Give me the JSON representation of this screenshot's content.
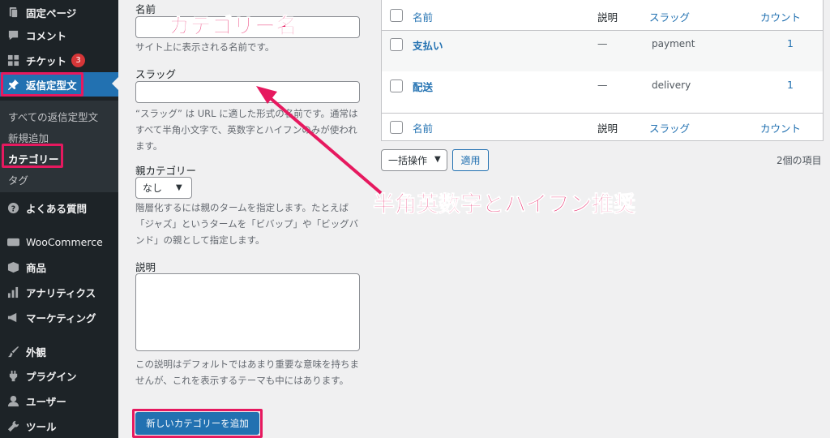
{
  "sidebar": {
    "items": [
      {
        "label": "固定ページ",
        "icon": "pages-icon"
      },
      {
        "label": "コメント",
        "icon": "comment-icon"
      },
      {
        "label": "チケット",
        "icon": "ticket-icon",
        "badge": "3"
      },
      {
        "label": "返信定型文",
        "icon": "pin-icon"
      },
      {
        "label": "よくある質問",
        "icon": "help-icon"
      },
      {
        "label": "WooCommerce",
        "icon": "woocommerce-icon"
      },
      {
        "label": "商品",
        "icon": "product-icon"
      },
      {
        "label": "アナリティクス",
        "icon": "analytics-icon"
      },
      {
        "label": "マーケティング",
        "icon": "megaphone-icon"
      },
      {
        "label": "外観",
        "icon": "brush-icon"
      },
      {
        "label": "プラグイン",
        "icon": "plugin-icon"
      },
      {
        "label": "ユーザー",
        "icon": "user-icon"
      },
      {
        "label": "ツール",
        "icon": "wrench-icon"
      }
    ],
    "submenu": [
      "すべての返信定型文",
      "新規追加",
      "カテゴリー",
      "タグ"
    ]
  },
  "form": {
    "name_label": "名前",
    "name_help": "サイト上に表示される名前です。",
    "slug_label": "スラッグ",
    "slug_help": "“スラッグ” は URL に適した形式の名前です。通常はすべて半角小文字で、英数字とハイフンのみが使われます。",
    "parent_label": "親カテゴリー",
    "parent_value": "なし",
    "parent_help": "階層化するには親のタームを指定します。たとえば「ジャズ」というタームを「ビバップ」や「ビッグバンド」の親として指定します。",
    "desc_label": "説明",
    "desc_help": "この説明はデフォルトではあまり重要な意味を持ちませんが、これを表示するテーマも中にはあります。",
    "submit_label": "新しいカテゴリーを追加"
  },
  "annotations": {
    "category_name": "カテゴリー名",
    "slug_note": "半角英数字とハイフン推奨"
  },
  "table": {
    "columns": {
      "name": "名前",
      "description": "説明",
      "slug": "スラッグ",
      "count": "カウント"
    },
    "rows": [
      {
        "name": "支払い",
        "description": "—",
        "slug": "payment",
        "count": "1"
      },
      {
        "name": "配送",
        "description": "—",
        "slug": "delivery",
        "count": "1"
      }
    ],
    "bulk_action": "一括操作",
    "apply_label": "適用",
    "items_count": "2個の項目"
  },
  "colors": {
    "accent": "#2271b1",
    "highlight": "#e6195f",
    "sidebar": "#1d2327"
  }
}
